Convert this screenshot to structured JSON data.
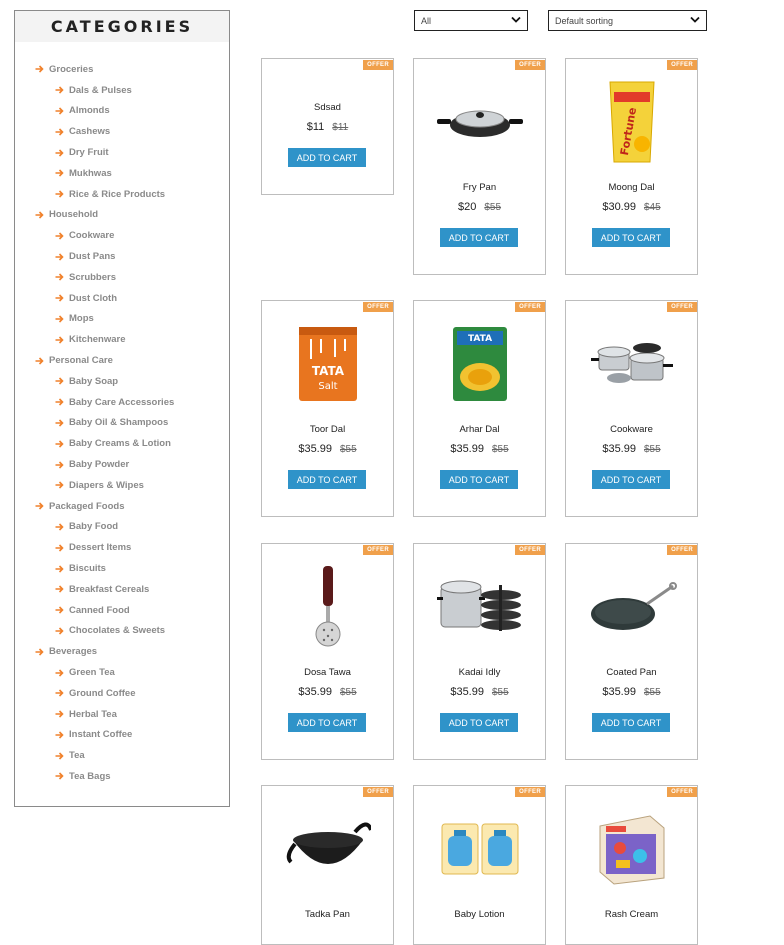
{
  "sidebar": {
    "title": "CATEGORIES",
    "items": [
      {
        "label": "Groceries",
        "level": "parent"
      },
      {
        "label": "Dals & Pulses",
        "level": "child"
      },
      {
        "label": "Almonds",
        "level": "child"
      },
      {
        "label": "Cashews",
        "level": "child"
      },
      {
        "label": "Dry Fruit",
        "level": "child"
      },
      {
        "label": "Mukhwas",
        "level": "child"
      },
      {
        "label": "Rice & Rice Products",
        "level": "child"
      },
      {
        "label": "Household",
        "level": "parent"
      },
      {
        "label": "Cookware",
        "level": "child"
      },
      {
        "label": "Dust Pans",
        "level": "child"
      },
      {
        "label": "Scrubbers",
        "level": "child"
      },
      {
        "label": "Dust Cloth",
        "level": "child"
      },
      {
        "label": "Mops",
        "level": "child"
      },
      {
        "label": "Kitchenware",
        "level": "child"
      },
      {
        "label": "Personal Care",
        "level": "parent"
      },
      {
        "label": "Baby Soap",
        "level": "child"
      },
      {
        "label": "Baby Care Accessories",
        "level": "child"
      },
      {
        "label": "Baby Oil & Shampoos",
        "level": "child"
      },
      {
        "label": "Baby Creams & Lotion",
        "level": "child"
      },
      {
        "label": "Baby Powder",
        "level": "child"
      },
      {
        "label": "Diapers & Wipes",
        "level": "child"
      },
      {
        "label": "Packaged Foods",
        "level": "parent"
      },
      {
        "label": "Baby Food",
        "level": "child"
      },
      {
        "label": "Dessert Items",
        "level": "child"
      },
      {
        "label": "Biscuits",
        "level": "child"
      },
      {
        "label": "Breakfast Cereals",
        "level": "child"
      },
      {
        "label": "Canned Food",
        "level": "child"
      },
      {
        "label": "Chocolates & Sweets",
        "level": "child"
      },
      {
        "label": "Beverages",
        "level": "parent"
      },
      {
        "label": "Green Tea",
        "level": "child"
      },
      {
        "label": "Ground Coffee",
        "level": "child"
      },
      {
        "label": "Herbal Tea",
        "level": "child"
      },
      {
        "label": "Instant Coffee",
        "level": "child"
      },
      {
        "label": "Tea",
        "level": "child"
      },
      {
        "label": "Tea Bags",
        "level": "child"
      }
    ]
  },
  "filters": {
    "category_value": "All",
    "sort_value": "Default sorting"
  },
  "colors": {
    "accent_arrow": "#f0812b",
    "badge": "#f0a04b",
    "button": "#2f93c9"
  },
  "badge_label": "OFFER",
  "button_label": "ADD TO CART",
  "products": [
    {
      "name": "Sdsad",
      "price": "$11",
      "old_price": "$11",
      "icon": "none"
    },
    {
      "name": "Fry Pan",
      "price": "$20",
      "old_price": "$55",
      "icon": "fry-pan-icon"
    },
    {
      "name": "Moong Dal",
      "price": "$30.99",
      "old_price": "$45",
      "icon": "oil-pack-icon"
    },
    {
      "name": "Toor Dal",
      "price": "$35.99",
      "old_price": "$55",
      "icon": "salt-pack-icon"
    },
    {
      "name": "Arhar Dal",
      "price": "$35.99",
      "old_price": "$55",
      "icon": "dal-pack-icon"
    },
    {
      "name": "Cookware",
      "price": "$35.99",
      "old_price": "$55",
      "icon": "cookware-set-icon"
    },
    {
      "name": "Dosa Tawa",
      "price": "$35.99",
      "old_price": "$55",
      "icon": "masher-icon"
    },
    {
      "name": "Kadai Idly",
      "price": "$35.99",
      "old_price": "$55",
      "icon": "idli-maker-icon"
    },
    {
      "name": "Coated Pan",
      "price": "$35.99",
      "old_price": "$55",
      "icon": "tawa-icon"
    },
    {
      "name": "Tadka Pan",
      "price": "",
      "old_price": "",
      "icon": "kadai-icon"
    },
    {
      "name": "Baby Lotion",
      "price": "",
      "old_price": "",
      "icon": "baby-lotion-icon"
    },
    {
      "name": "Rash Cream",
      "price": "",
      "old_price": "",
      "icon": "rash-cream-box-icon"
    }
  ]
}
